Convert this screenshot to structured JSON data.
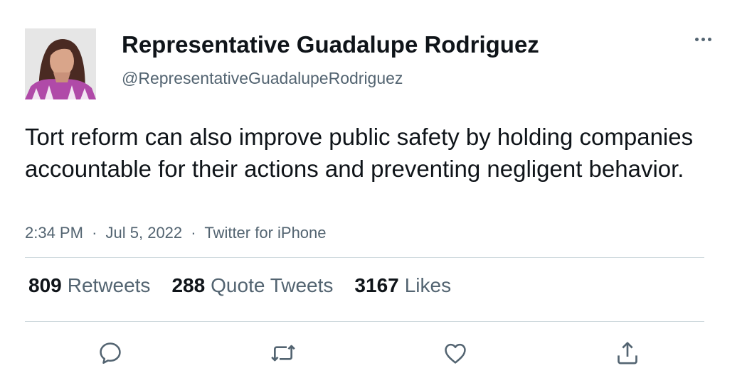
{
  "author": {
    "display_name": "Representative Guadalupe Rodriguez",
    "handle": "@RepresentativeGuadalupeRodriguez",
    "avatar_icon": "profile-photo"
  },
  "tweet": {
    "text": "Tort reform can also improve public safety by holding companies accountable for their actions and preventing negligent behavior.",
    "time": "2:34 PM",
    "date": "Jul 5, 2022",
    "source": "Twitter for iPhone",
    "separator": "·"
  },
  "stats": {
    "retweets": {
      "count": "809",
      "label": "Retweets"
    },
    "quotes": {
      "count": "288",
      "label": "Quote Tweets"
    },
    "likes": {
      "count": "3167",
      "label": "Likes"
    }
  },
  "actions": [
    "reply-icon",
    "retweet-icon",
    "like-icon",
    "share-icon"
  ],
  "colors": {
    "text": "#0f1419",
    "secondary": "#536471",
    "divider": "#cfd9de"
  }
}
